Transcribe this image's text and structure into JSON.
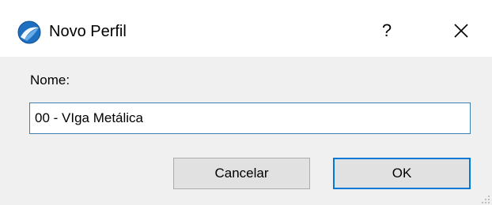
{
  "window": {
    "title": "Novo Perfil",
    "help_label": "?",
    "app_icon": "archicad-logo-icon",
    "close_icon": "close-icon"
  },
  "form": {
    "name_label": "Nome:",
    "name_value": "00 - VIga Metálica"
  },
  "buttons": {
    "cancel_label": "Cancelar",
    "ok_label": "OK"
  },
  "colors": {
    "accent": "#0078d7",
    "input_border": "#3c7fb1",
    "dialog_bg": "#f0f0f0",
    "button_bg": "#e1e1e1"
  }
}
